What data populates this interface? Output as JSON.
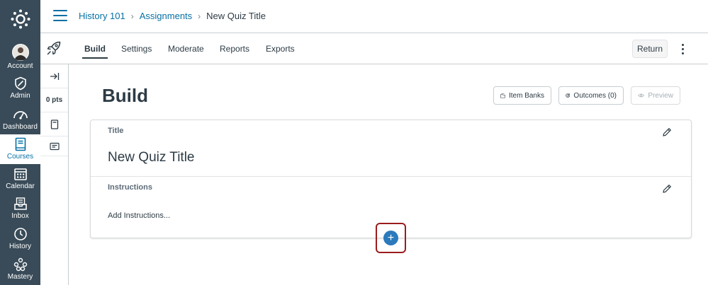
{
  "global_nav": {
    "items": [
      {
        "id": "account",
        "label": "Account",
        "icon": "avatar"
      },
      {
        "id": "admin",
        "label": "Admin",
        "icon": "shield-icon"
      },
      {
        "id": "dashboard",
        "label": "Dashboard",
        "icon": "speedometer-icon"
      },
      {
        "id": "courses",
        "label": "Courses",
        "icon": "book-icon",
        "active": true
      },
      {
        "id": "calendar",
        "label": "Calendar",
        "icon": "calendar-icon"
      },
      {
        "id": "inbox",
        "label": "Inbox",
        "icon": "inbox-icon"
      },
      {
        "id": "history",
        "label": "History",
        "icon": "clock-icon"
      },
      {
        "id": "mastery",
        "label": "Mastery",
        "icon": "nodes-icon"
      }
    ]
  },
  "breadcrumb": {
    "course": "History 101",
    "section": "Assignments",
    "current": "New Quiz Title",
    "separator": "›"
  },
  "tabs": {
    "items": [
      "Build",
      "Settings",
      "Moderate",
      "Reports",
      "Exports"
    ],
    "active": "Build",
    "return_label": "Return"
  },
  "tool_column": {
    "points": "0 pts"
  },
  "main": {
    "page_title": "Build",
    "item_banks_label": "Item Banks",
    "outcomes_label": "Outcomes (0)",
    "preview_label": "Preview",
    "title_section_label": "Title",
    "quiz_title": "New Quiz Title",
    "instructions_section_label": "Instructions",
    "instructions_placeholder": "Add Instructions...",
    "add_button_glyph": "+"
  },
  "colors": {
    "nav_bg": "#394b58",
    "link": "#0770a3",
    "add_button": "#2b7abc",
    "highlight": "#9b1c1c"
  }
}
